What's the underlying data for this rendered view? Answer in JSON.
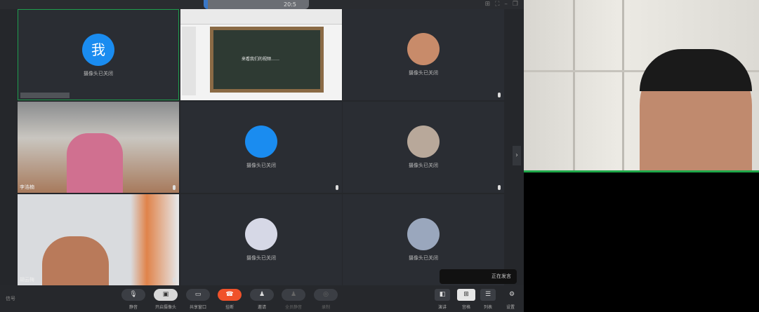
{
  "title": {
    "text": "20:5"
  },
  "window_controls": [
    "⊞",
    "⛶",
    "–",
    "❐"
  ],
  "tiles": [
    {
      "name": "",
      "avatar_text": "我",
      "caption": "摄像头已关闭"
    },
    {
      "name": "",
      "caption": "",
      "slide_text": "来看我们的视频……"
    },
    {
      "name": "",
      "caption": "摄像头已关闭"
    },
    {
      "name": "李浩楠",
      "caption": ""
    },
    {
      "name": "",
      "caption": "摄像头已关闭"
    },
    {
      "name": "",
      "caption": "摄像头已关闭"
    },
    {
      "name": "胡云梅",
      "caption": ""
    },
    {
      "name": "",
      "caption": "摄像头已关闭"
    },
    {
      "name": "",
      "caption": "摄像头已关闭"
    }
  ],
  "speaking": "正在发言",
  "next_arrow": "›",
  "toolbar": {
    "signal": "信号",
    "buttons": [
      {
        "icon": "🎙",
        "label": "静音"
      },
      {
        "icon": "▣",
        "label": "开启摄像头"
      },
      {
        "icon": "▭",
        "label": "共享窗口"
      },
      {
        "icon": "☎",
        "label": "挂断"
      },
      {
        "icon": "♟",
        "label": "邀请"
      },
      {
        "icon": "♟",
        "label": "全员静音"
      },
      {
        "icon": "◎",
        "label": "录制"
      }
    ],
    "views": [
      {
        "icon": "◧",
        "label": "演讲"
      },
      {
        "icon": "⊞",
        "label": "宫格"
      },
      {
        "icon": "☰",
        "label": "列表"
      },
      {
        "icon": "⚙",
        "label": "设置"
      }
    ]
  },
  "colors": {
    "hangup": "#f0522a",
    "accent": "#1a8cf0",
    "active": "#1f9d4e"
  }
}
